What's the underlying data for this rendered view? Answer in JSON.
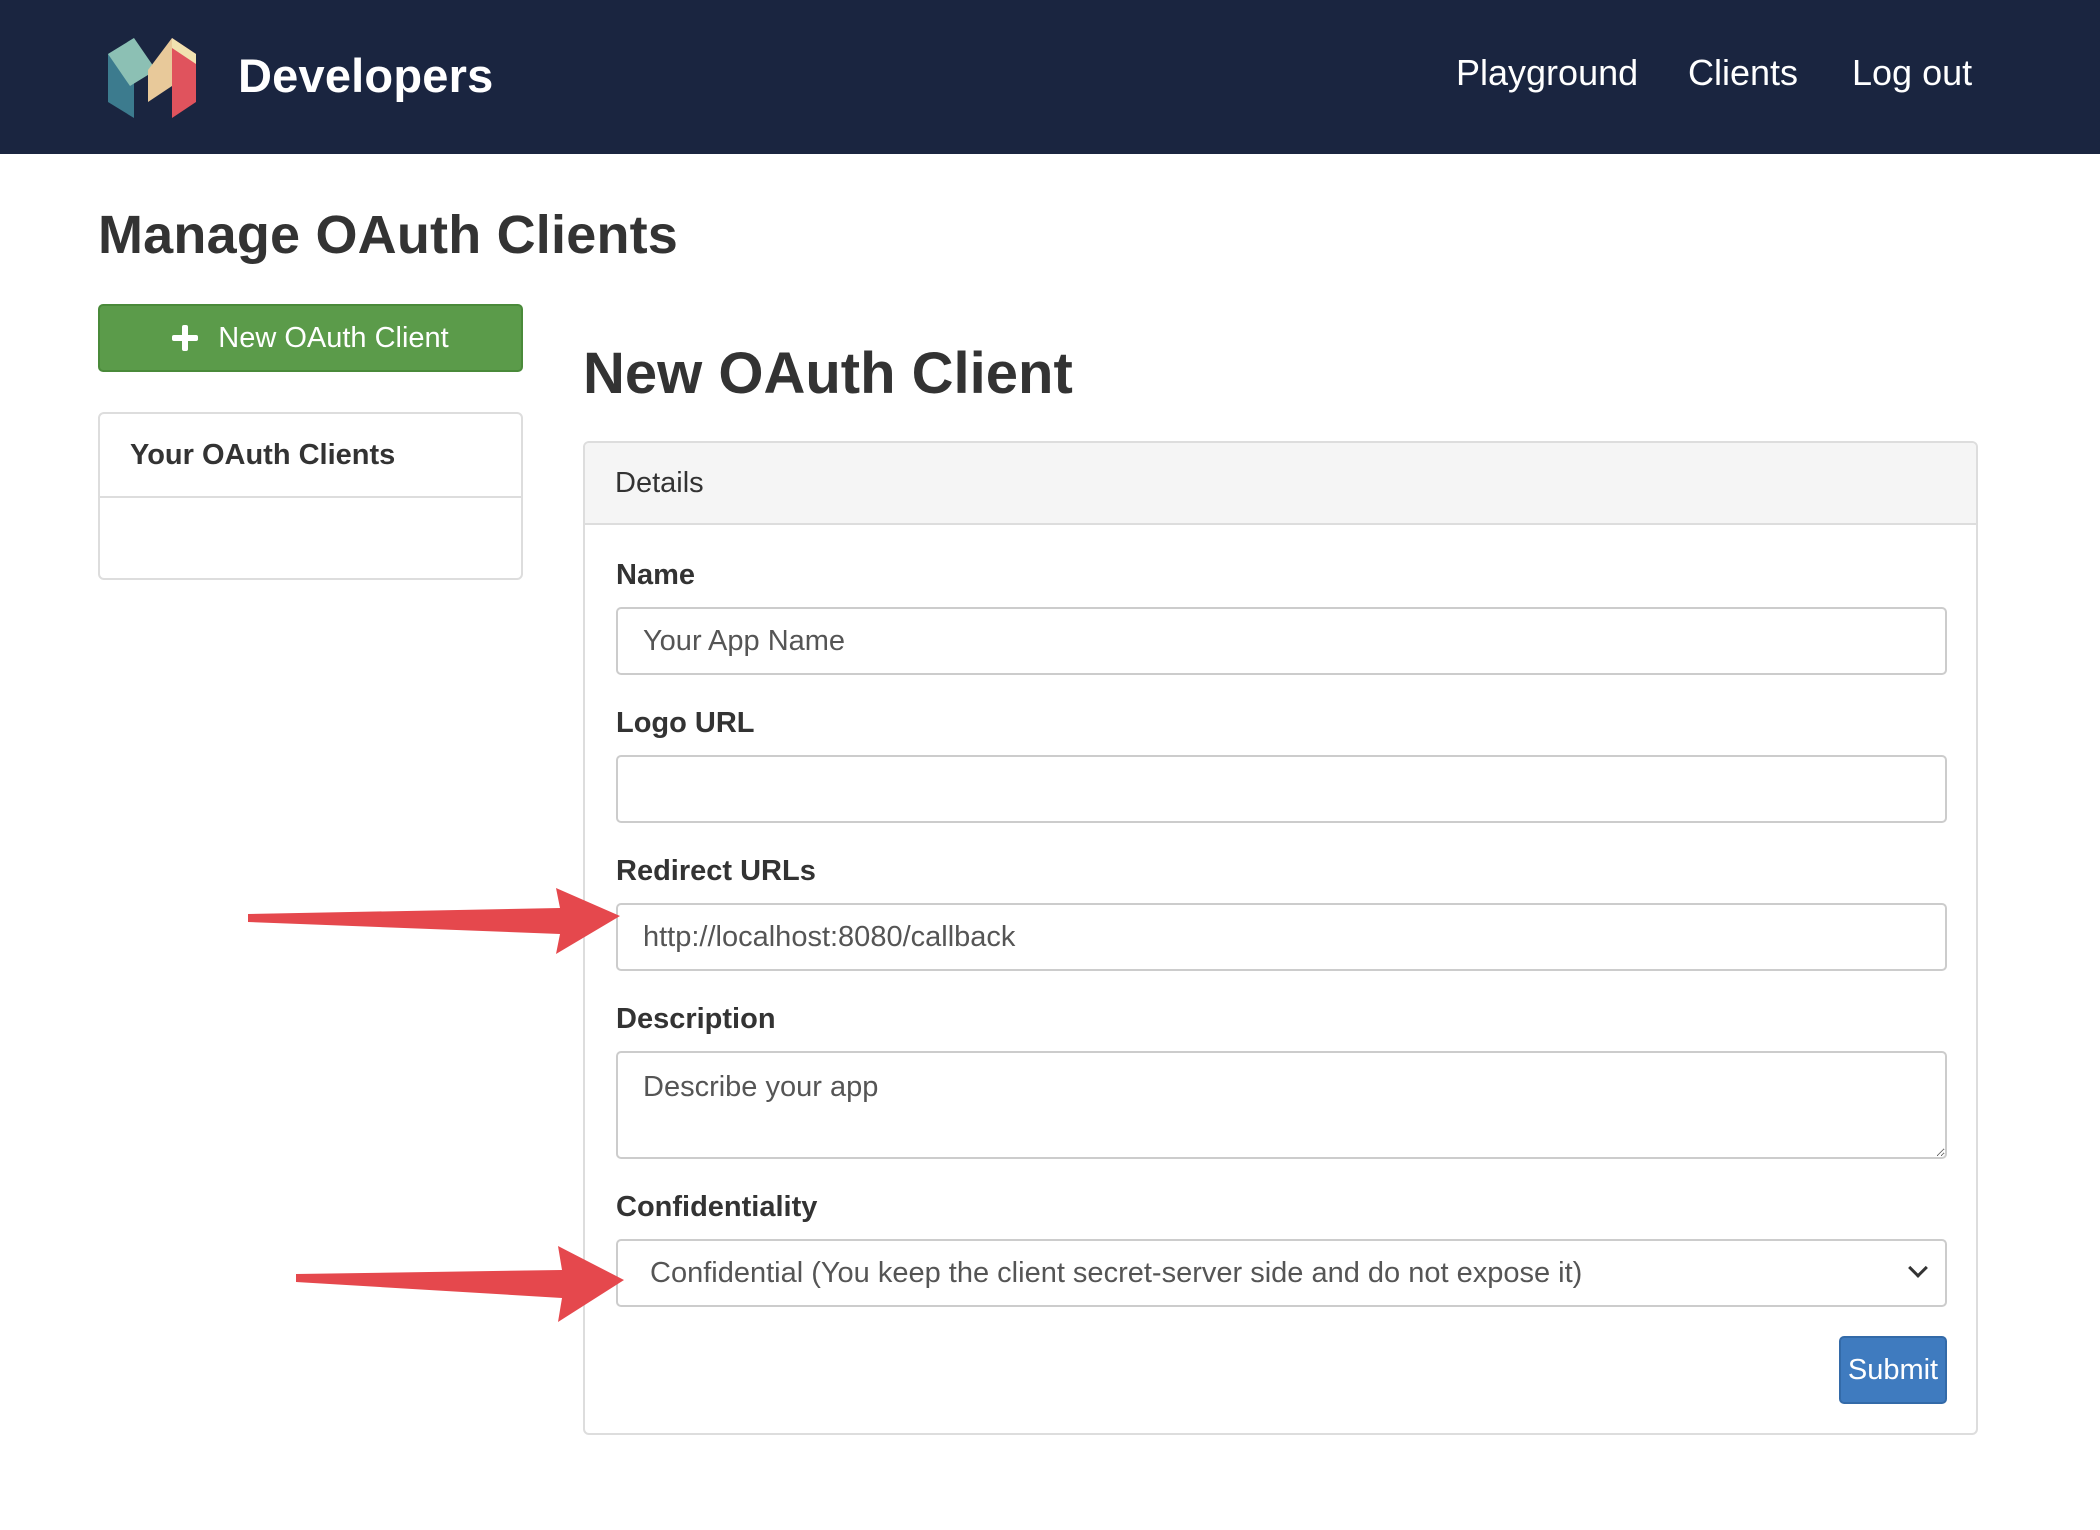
{
  "header": {
    "brand_text": "Developers",
    "nav": {
      "playground": "Playground",
      "clients": "Clients",
      "logout": "Log out"
    },
    "background_color": "#1a2540"
  },
  "page_title": "Manage OAuth Clients",
  "sidebar": {
    "new_client_button": "New OAuth Client",
    "clients_panel_title": "Your OAuth Clients"
  },
  "form": {
    "title": "New OAuth Client",
    "panel_heading": "Details",
    "name": {
      "label": "Name",
      "placeholder": "Your App Name",
      "value": ""
    },
    "logo_url": {
      "label": "Logo URL",
      "value": ""
    },
    "redirect_urls": {
      "label": "Redirect URLs",
      "value": "http://localhost:8080/callback"
    },
    "description": {
      "label": "Description",
      "placeholder": "Describe your app"
    },
    "confidentiality": {
      "label": "Confidentiality",
      "selected": "Confidential (You keep the client secret-server side and do not expose it)"
    },
    "submit_label": "Submit"
  },
  "colors": {
    "success_button": "#5b9b4a",
    "primary_button": "#3f7bbf",
    "annotation_arrow": "#e5484d"
  }
}
